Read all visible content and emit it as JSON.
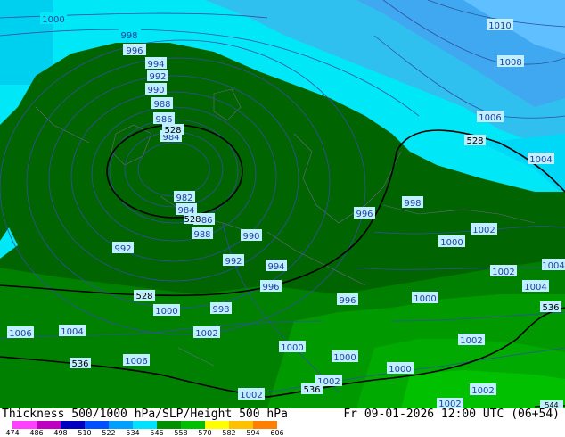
{
  "title_left": "Thickness 500/1000 hPa/SLP/Height 500 hPa",
  "title_right": "Fr 09-01-2026 12:00 UTC (06+54)",
  "colors": {
    "cyan_light": "#00e8f8",
    "cyan_mid": "#00cdf0",
    "blue_sky": "#30b0f0",
    "green_dark": "#006400",
    "green_mid": "#008c00",
    "green_bright": "#00b000"
  },
  "scale": {
    "labels": [
      "474",
      "486",
      "498",
      "510",
      "522",
      "534",
      "546",
      "558",
      "570",
      "582",
      "594",
      "606"
    ],
    "colors": [
      "#ff40ff",
      "#c000c0",
      "#0000c0",
      "#0050ff",
      "#00a0ff",
      "#00e0ff",
      "#009000",
      "#00c000",
      "#ffff00",
      "#ffc000",
      "#ff8000"
    ]
  },
  "isobar_labels": [
    "1000",
    "998",
    "996",
    "994",
    "992",
    "990",
    "988",
    "986",
    "984",
    "982",
    "984",
    "986",
    "988",
    "990",
    "992",
    "994",
    "996",
    "998",
    "1000",
    "1002",
    "1004",
    "1006",
    "1008",
    "1010",
    "998",
    "996",
    "994",
    "1000",
    "1002",
    "1004",
    "1006",
    "1004",
    "1002",
    "1000",
    "1002",
    "1000",
    "1002",
    "1002",
    "1006",
    "1004",
    "1002",
    "1004",
    "1002",
    "1000",
    "996",
    "992",
    "990",
    "1000",
    "998",
    "998",
    "1004",
    "1006",
    "1006",
    "1002",
    "1002"
  ],
  "thickness_labels": [
    "528",
    "528",
    "528",
    "536",
    "536",
    "536",
    "544",
    "528"
  ]
}
